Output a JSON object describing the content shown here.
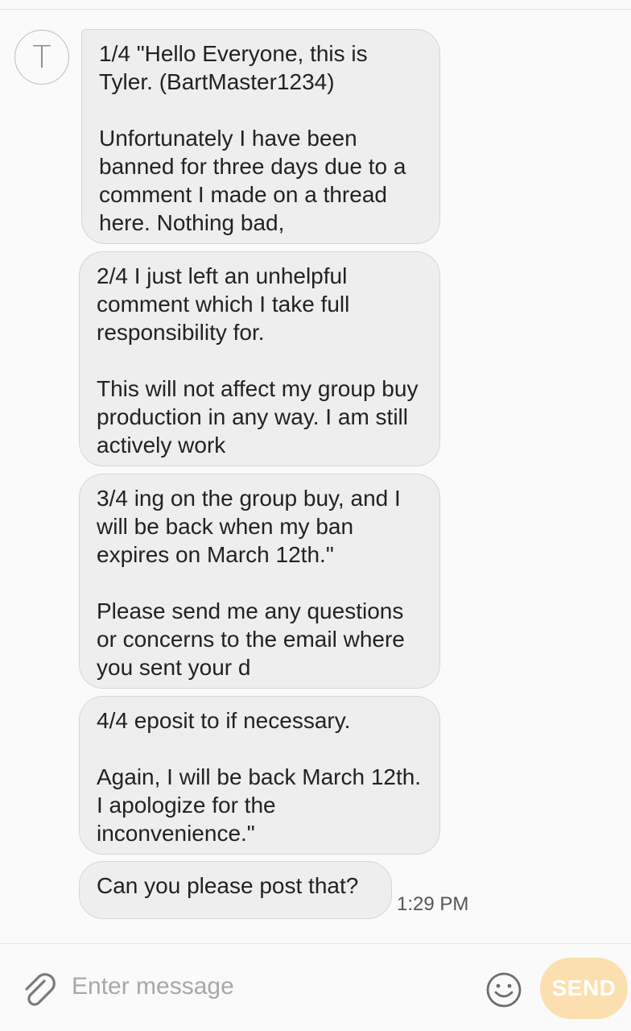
{
  "contact": {
    "avatar_initial": "T"
  },
  "messages": [
    {
      "text": "1/4 \"Hello Everyone, this is Tyler. (BartMaster1234)\n\nUnfortunately I have been banned for three days due to a comment I made on a thread here. Nothing bad,"
    },
    {
      "text": "2/4 I just left an unhelpful comment which I take full responsibility for.\n\nThis will not affect my group buy production in any way. I am still actively work"
    },
    {
      "text": "3/4 ing on the group buy, and I will be back when my ban expires on March 12th.\"\n\nPlease send me any questions or concerns to the email where you sent your d"
    },
    {
      "text": "4/4 eposit to if necessary.\n\nAgain, I will be back March 12th. I apologize for the inconvenience.\""
    },
    {
      "text": "Can you please post that?"
    }
  ],
  "timestamp": "1:29 PM",
  "composer": {
    "placeholder": "Enter message",
    "value": "",
    "send_label": "SEND",
    "send_color": "#fcdfae"
  },
  "icons": {
    "attach": "paperclip-icon",
    "emoji": "smiley-icon"
  }
}
